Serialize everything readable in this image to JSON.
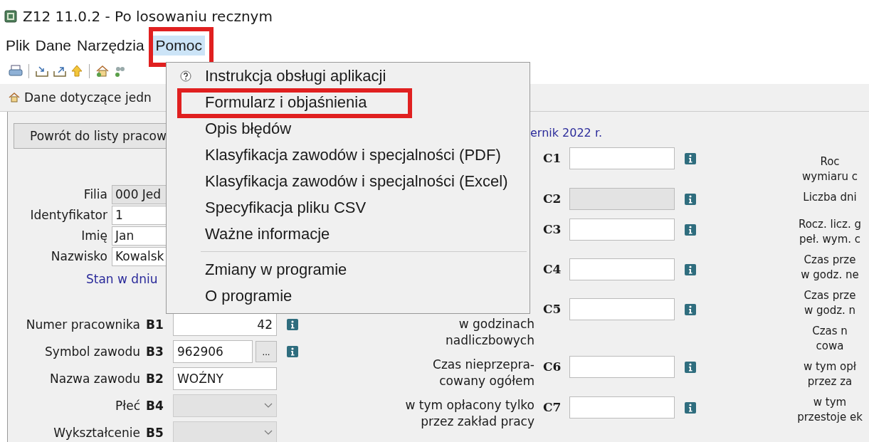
{
  "window": {
    "title": "Z12 11.0.2 - Po losowaniu recznym"
  },
  "menu_bar": [
    {
      "label": "Plik",
      "selected": false,
      "marked": false
    },
    {
      "label": "Dane",
      "selected": false,
      "marked": false
    },
    {
      "label": "Narzędzia",
      "selected": false,
      "marked": false
    },
    {
      "label": "Pomoc",
      "selected": true,
      "marked": true
    }
  ],
  "help_menu": [
    {
      "kind": "icon-item",
      "label": "Instrukcja obsługi aplikacji",
      "marked": false
    },
    {
      "kind": "item",
      "label": "Formularz i objaśnienia",
      "marked": true
    },
    {
      "kind": "item",
      "label": "Opis błędów",
      "marked": false
    },
    {
      "kind": "item",
      "label": "Klasyfikacja zawodów i specjalności (PDF)",
      "marked": false
    },
    {
      "kind": "item",
      "label": "Klasyfikacja zawodów i specjalności (Excel)",
      "marked": false
    },
    {
      "kind": "item",
      "label": "Specyfikacja pliku CSV",
      "marked": false
    },
    {
      "kind": "item",
      "label": "Ważne informacje",
      "marked": false
    },
    {
      "kind": "separator"
    },
    {
      "kind": "item",
      "label": "Zmiany w programie",
      "marked": false
    },
    {
      "kind": "item",
      "label": "O programie",
      "marked": false
    }
  ],
  "tab": {
    "label": "Dane dotyczące jedn"
  },
  "back_button": {
    "label": "Powrót do listy pracow"
  },
  "employee_fields": [
    {
      "label": "Filia",
      "value": "000 Jed",
      "disabled": true
    },
    {
      "label": "Identyfikator",
      "value": "1",
      "disabled": false
    },
    {
      "label": "Imię",
      "value": "Jan",
      "disabled": false
    },
    {
      "label": "Nazwisko",
      "value": "Kowalsk",
      "disabled": false
    }
  ],
  "state_heading": "Stan w dniu",
  "b_fields": [
    {
      "label": "Numer pracownika",
      "code": "B1",
      "kind": "number",
      "value": "42",
      "disabled": false,
      "info": true
    },
    {
      "label": "Symbol zawodu",
      "code": "B3",
      "kind": "lookup",
      "value": "962906",
      "button": "...",
      "disabled": false,
      "info": true
    },
    {
      "label": "Nazwa zawodu",
      "code": "B2",
      "kind": "text",
      "value": "WOŹNY",
      "disabled": false,
      "info": false
    },
    {
      "label": "Płeć",
      "code": "B4",
      "kind": "select",
      "disabled": true,
      "info": false
    },
    {
      "label": "Wykształcenie",
      "code": "B5",
      "kind": "select",
      "disabled": true,
      "info": false
    }
  ],
  "period_heading": "ernik 2022 r.",
  "c_fields": [
    {
      "code": "C1",
      "disabled": false
    },
    {
      "code": "C2",
      "disabled": true
    },
    {
      "code": "C3",
      "disabled": false
    },
    {
      "code": "C4",
      "disabled": false
    },
    {
      "code": "C5",
      "label_lines": [
        "w godzinach",
        "nadliczbowych"
      ],
      "disabled": false
    },
    {
      "code": "C6",
      "label_lines": [
        "Czas nieprzepra-",
        "cowany ogółem"
      ],
      "disabled": false
    },
    {
      "code": "C7",
      "label_lines": [
        "w tym opłacony tylko",
        "przez zakład pracy"
      ],
      "disabled": false
    }
  ],
  "right_labels": [
    {
      "lines": [
        "Roc",
        "wymiaru c"
      ]
    },
    {
      "lines": [
        "Liczba dni"
      ]
    },
    {
      "lines": [
        "Rocz. licz. g",
        "peł. wym. c"
      ]
    },
    {
      "lines": [
        "Czas prze",
        "w godz. ne"
      ]
    },
    {
      "lines": [
        "Czas prze",
        "w godz. n"
      ]
    },
    {
      "lines": [
        "Czas n",
        "cowa"
      ]
    },
    {
      "lines": [
        "w tym opł",
        "przez za"
      ]
    },
    {
      "lines": [
        "w tym",
        "przestoje ek"
      ]
    }
  ]
}
